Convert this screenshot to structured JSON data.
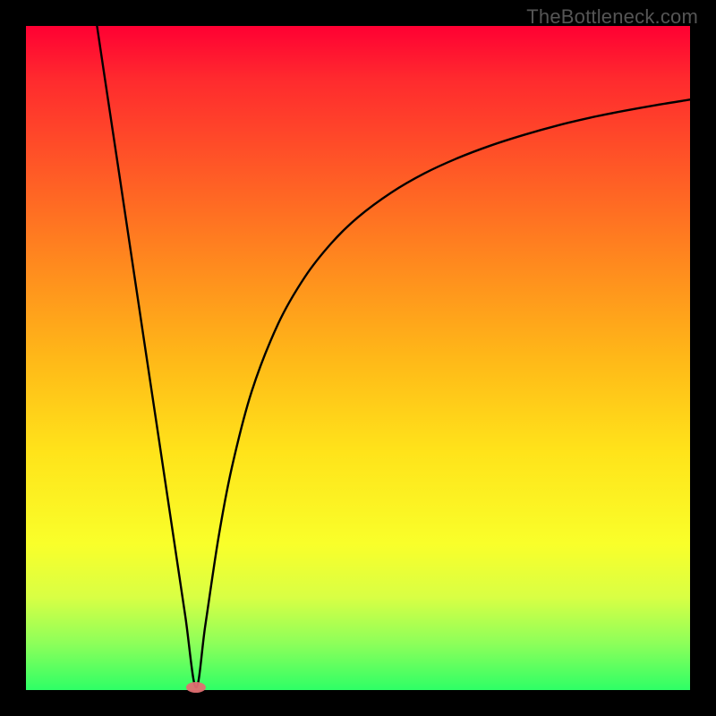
{
  "watermark": "TheBottleneck.com",
  "chart_data": {
    "type": "line",
    "title": "",
    "xlabel": "",
    "ylabel": "",
    "xlim": [
      0,
      100
    ],
    "ylim": [
      0,
      100
    ],
    "grid": false,
    "legend": false,
    "background_gradient": {
      "top": "#ff0033",
      "bottom": "#2eff66"
    },
    "series": [
      {
        "name": "curve",
        "color": "#000000",
        "x": [
          10.7,
          12,
          14,
          16,
          18,
          20,
          22,
          24,
          25.6,
          27,
          29,
          31,
          34,
          38,
          42,
          46,
          50,
          55,
          60,
          65,
          70,
          75,
          80,
          85,
          90,
          95,
          100
        ],
        "y": [
          100,
          91.3,
          78.0,
          64.6,
          51.2,
          37.9,
          24.5,
          11.1,
          0.4,
          9.7,
          23.0,
          33.5,
          45.0,
          55.2,
          62.2,
          67.3,
          71.2,
          74.9,
          77.8,
          80.1,
          82.0,
          83.6,
          85.0,
          86.2,
          87.2,
          88.1,
          88.9
        ]
      }
    ],
    "marker": {
      "x": 25.6,
      "y": 0.4,
      "color": "#e26f72",
      "shape": "capsule"
    }
  }
}
